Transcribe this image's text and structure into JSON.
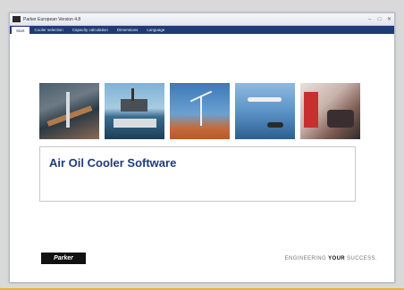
{
  "window": {
    "title": "Parker European Version 4.8"
  },
  "controls": {
    "minimize": "–",
    "maximize": "□",
    "close": "✕"
  },
  "menu": {
    "items": [
      {
        "label": "Start"
      },
      {
        "label": "Cooler selection"
      },
      {
        "label": "Capacity calculation"
      },
      {
        "label": "Dimensions"
      },
      {
        "label": "Language"
      }
    ]
  },
  "main": {
    "app_title": "Air Oil Cooler Software"
  },
  "footer": {
    "logo_text": "Parker",
    "slogan_prefix": "ENGINEERING ",
    "slogan_bold": "YOUR",
    "slogan_suffix": " SUCCESS."
  },
  "colors": {
    "menu_bg": "#1f3a7a",
    "title_color": "#1f3a7a",
    "accent_line": "#e0b33a"
  },
  "icons": [
    "app-icon",
    "minimize-icon",
    "maximize-icon",
    "close-icon"
  ]
}
